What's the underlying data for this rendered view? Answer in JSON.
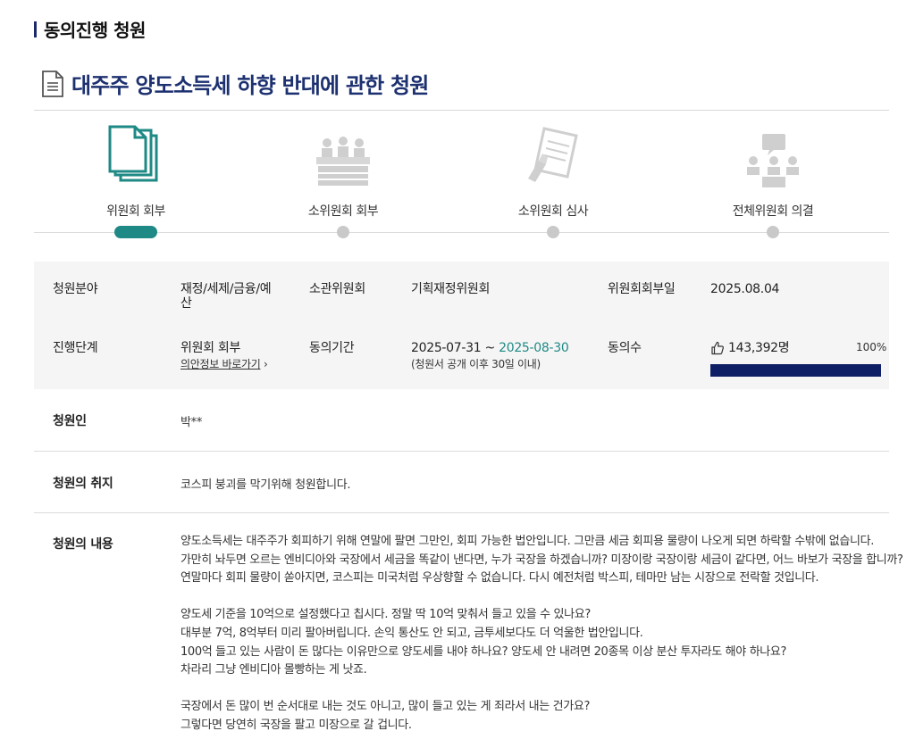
{
  "section": {
    "title": "동의진행 청원"
  },
  "petition": {
    "title": "대주주 양도소득세 하향 반대에 관한 청원"
  },
  "steps": [
    {
      "label": "위원회 회부",
      "active": true,
      "icon": "documents-icon"
    },
    {
      "label": "소위원회 회부",
      "active": false,
      "icon": "meeting-icon"
    },
    {
      "label": "소위원회 심사",
      "active": false,
      "icon": "review-icon"
    },
    {
      "label": "전체위원회 의결",
      "active": false,
      "icon": "plenary-icon"
    }
  ],
  "info": {
    "field_label": "청원분야",
    "field_value": "재정/세제/금융/예산",
    "committee_label": "소관위원회",
    "committee_value": "기획재정위원회",
    "referral_date_label": "위원회회부일",
    "referral_date_value": "2025.08.04",
    "stage_label": "진행단계",
    "stage_value": "위원회 회부",
    "stage_link": "의안정보 바로가기",
    "period_label": "동의기간",
    "period_start": "2025-07-31",
    "period_sep": " ~ ",
    "period_end": "2025-08-30",
    "period_note": "(청원서 공개 이후 30일 이내)",
    "agree_label": "동의수",
    "agree_count": "143,392명",
    "agree_percent_text": "100%",
    "agree_percent": 100
  },
  "petitioner": {
    "label": "청원인",
    "value": "박**"
  },
  "purpose": {
    "label": "청원의 취지",
    "value": "코스피 붕괴를 막기위해 청원합니다."
  },
  "content": {
    "label": "청원의 내용",
    "paragraphs": [
      [
        "양도소득세는 대주주가 회피하기 위해 연말에 팔면 그만인, 회피 가능한 법안입니다. 그만큼 세금 회피용 물량이 나오게 되면 하락할 수밖에 없습니다.",
        "가만히 놔두면 오르는 엔비디아와 국장에서 세금을 똑같이 낸다면, 누가 국장을 하겠습니까? 미장이랑 국장이랑 세금이 같다면, 어느 바보가 국장을 합니까?",
        "연말마다 회피 물량이 쏟아지면, 코스피는 미국처럼 우상향할 수 없습니다. 다시 예전처럼 박스피, 테마만 남는 시장으로 전락할 것입니다."
      ],
      [
        "양도세 기준을 10억으로 설정했다고 칩시다. 정말 딱 10억 맞춰서 들고 있을 수 있나요?",
        "대부분 7억, 8억부터 미리 팔아버립니다. 손익 통산도 안 되고, 금투세보다도 더 억울한 법안입니다.",
        "100억 들고 있는 사람이 돈 많다는 이유만으로 양도세를 내야 하나요? 양도세 안 내려면 20종목 이상 분산 투자라도 해야 하나요?",
        "차라리 그냥 엔비디아 몰빵하는 게 낫죠."
      ],
      [
        "국장에서 돈 많이 번 순서대로 내는 것도 아니고, 많이 들고 있는 게 죄라서 내는 건가요?",
        "그렇다면 당연히 국장을 팔고 미장으로 갈 겁니다."
      ]
    ]
  },
  "colors": {
    "accent": "#1d3170",
    "teal": "#1f8a85",
    "progress": "#0f1f66"
  }
}
